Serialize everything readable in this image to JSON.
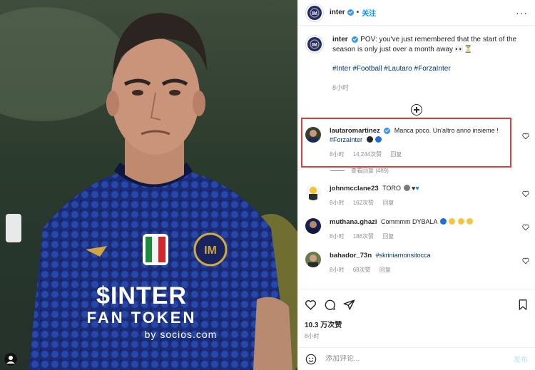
{
  "post": {
    "author": "inter",
    "follow_label": "关注",
    "more_label": "···",
    "separator": "•"
  },
  "caption": {
    "author": "inter",
    "text": "POV: you've just remembered that the start of the season is only just over a month away 👀⏳",
    "hashtags": "#Inter #Football #Lautaro #ForzaInter",
    "time": "8小时"
  },
  "jersey": {
    "sponsor": "$INTER",
    "sponsor_line2": "FAN TOKEN",
    "sponsor_line3": "by socios.com"
  },
  "comments": [
    {
      "user": "lautaromartinez",
      "verified": true,
      "text": "Manca poco. Un'altro anno insieme !",
      "tag": "#ForzaInter",
      "time": "8小时",
      "likes": "14,244次赞",
      "reply": "回复",
      "view_replies": "查看回复 (489)"
    },
    {
      "user": "johnmcclane23",
      "text": "TORO",
      "time": "8小时",
      "likes": "162次赞",
      "reply": "回复"
    },
    {
      "user": "muthana.ghazi",
      "text": "Commmm DYBALA",
      "time": "8小时",
      "likes": "188次赞",
      "reply": "回复"
    },
    {
      "user": "bahador_73n",
      "text": "#skriniarnonsitocca",
      "time": "8小时",
      "likes": "68次赞",
      "reply": "回复"
    }
  ],
  "stats": {
    "likes": "10.3 万次赞",
    "time": "8小时"
  },
  "composer": {
    "placeholder": "添加评论...",
    "post_label": "发布"
  },
  "colors": {
    "link": "#00376b",
    "accent": "#0095f6",
    "highlight": "#e23b3b",
    "inter_blue": "#1a2b7c"
  }
}
